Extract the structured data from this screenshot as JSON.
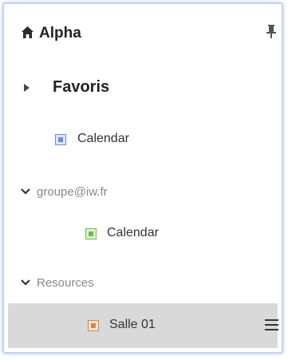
{
  "header": {
    "title": "Alpha",
    "home_icon": "home-icon",
    "pin_icon": "pin-icon"
  },
  "favoris": {
    "label": "Favoris",
    "expanded": false
  },
  "favoris_items": [
    {
      "label": "Calendar",
      "color": "#6d8fce"
    }
  ],
  "groups": [
    {
      "label": "groupe@iw.fr",
      "expanded": true,
      "items": [
        {
          "label": "Calendar",
          "color": "#72b955"
        }
      ]
    },
    {
      "label": "Resources",
      "expanded": true,
      "items": [
        {
          "label": "Salle 01",
          "color": "#c98a5b",
          "selected": true,
          "menu_icon": "hamburger-menu-icon"
        }
      ]
    }
  ]
}
